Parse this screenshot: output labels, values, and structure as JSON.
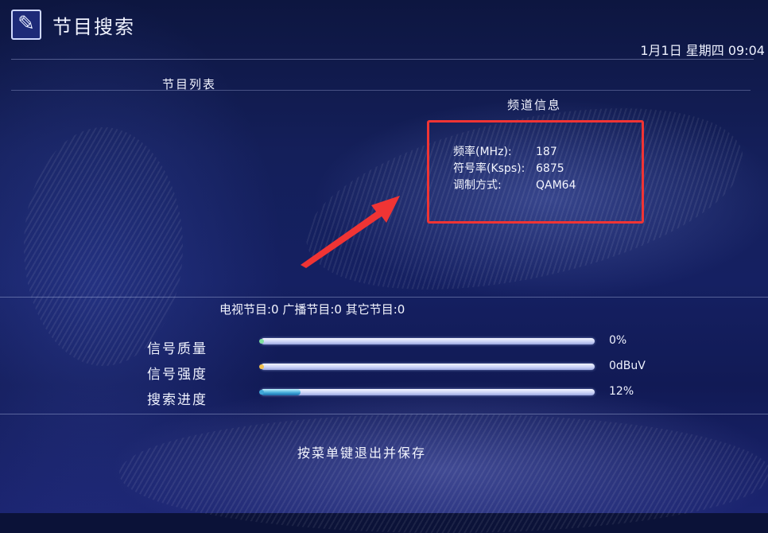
{
  "title": "节目搜索",
  "datetime": "1月1日 星期四 09:04",
  "panel": {
    "left_header": "节目列表",
    "right_header": "频道信息"
  },
  "channel_info": [
    {
      "label": "频率(MHz):",
      "value": "187"
    },
    {
      "label": "符号率(Ksps):",
      "value": "6875"
    },
    {
      "label": "调制方式:",
      "value": "QAM64"
    }
  ],
  "counts": "电视节目:0 广播节目:0 其它节目:0",
  "meters": [
    {
      "label": "信号质量",
      "value": "0%",
      "level": 0,
      "dot_color": "#7fe0a0"
    },
    {
      "label": "信号强度",
      "value": "0dBuV",
      "level": 0,
      "dot_color": "#f2c14e"
    },
    {
      "label": "搜索进度",
      "value": "12%",
      "level": 0.12,
      "dot_color": "#3fa7d8"
    }
  ],
  "footer_hint": "按菜单键退出并保存",
  "colors": {
    "highlight_box": "#f03434",
    "arrow": "#f03434",
    "background": "#141f5a"
  },
  "icons": {
    "title": "edit-icon"
  }
}
